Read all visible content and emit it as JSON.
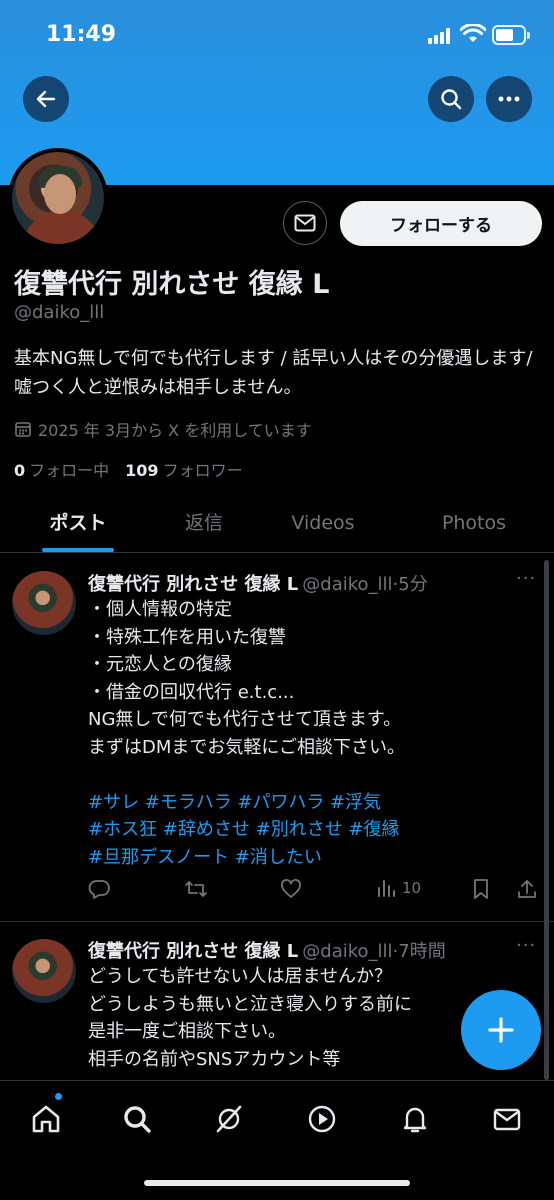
{
  "status_bar": {
    "time": "11:49",
    "battery_level": 0.65
  },
  "profile": {
    "name": "復讐代行 別れさせ 復縁 L",
    "handle": "@daiko_lll",
    "bio": "基本NG無しで何でも代行します / 話早い人はその分優遇します/ 嘘つく人と逆恨みは相手しません。",
    "joined": "2025 年 3月から X を利用しています",
    "following_count": "0",
    "following_label": "フォロー中",
    "followers_count": "109",
    "followers_label": "フォロワー",
    "follow_button": "フォローする"
  },
  "tabs": [
    {
      "label": "ポスト",
      "active": true
    },
    {
      "label": "返信"
    },
    {
      "label": "Videos"
    },
    {
      "label": "Photos"
    }
  ],
  "posts": [
    {
      "name": "復讐代行 別れさせ 復縁 L",
      "handle_time": "@daiko_lll·5分",
      "lines": [
        "・個人情報の特定",
        "・特殊工作を用いた復讐",
        "・元恋人との復縁",
        "・借金の回収代行 e.t.c...",
        "NG無しで何でも代行させて頂きます。",
        "まずはDMまでお気軽にご相談下さい。"
      ],
      "tags": [
        "#サレ #モラハラ #パワハラ #浮気",
        "#ホス狂 #辞めさせ #別れさせ #復縁",
        "#旦那デスノート #消したい"
      ],
      "views": "10"
    },
    {
      "name": "復讐代行 別れさせ 復縁 L",
      "handle_time": "@daiko_lll·7時間",
      "lines": [
        "どうしても許せない人は居ませんか？",
        "どうしようも無いと泣き寝入りする前に",
        "是非一度ご相談下さい。",
        "相手の名前やSNSアカウント等"
      ]
    }
  ],
  "colors": {
    "accent": "#1d9bf0",
    "background": "#000000",
    "banner": "#1d9bf0"
  }
}
